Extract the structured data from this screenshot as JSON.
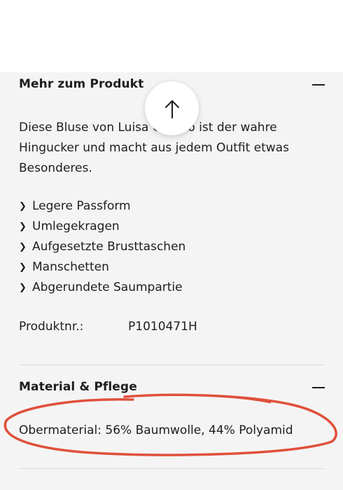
{
  "product_details": {
    "title": "Mehr zum Produkt",
    "description": "Diese Bluse von Luisa Cerano ist der wahre\nHingucker und macht aus jedem Outfit etwas\nBesonderes.",
    "features": [
      "Legere Passform",
      "Umlegekragen",
      "Aufgesetzte Brusttaschen",
      "Manschetten",
      "Abgerundete Saumpartie"
    ],
    "product_number_label": "Produktnr.:",
    "product_number_value": "P1010471H"
  },
  "material_care": {
    "title": "Material & Pflege",
    "material_text": "Obermaterial: 56% Baumwolle, 44% Polyamid"
  },
  "icons": {
    "scroll_top": "arrow-up-icon",
    "collapse": "minus-icon",
    "bullet": "chevron-right-icon"
  },
  "colors": {
    "panel_background": "#f4f4f4",
    "text": "#1e1e1e",
    "annotation": "#e0503c"
  }
}
